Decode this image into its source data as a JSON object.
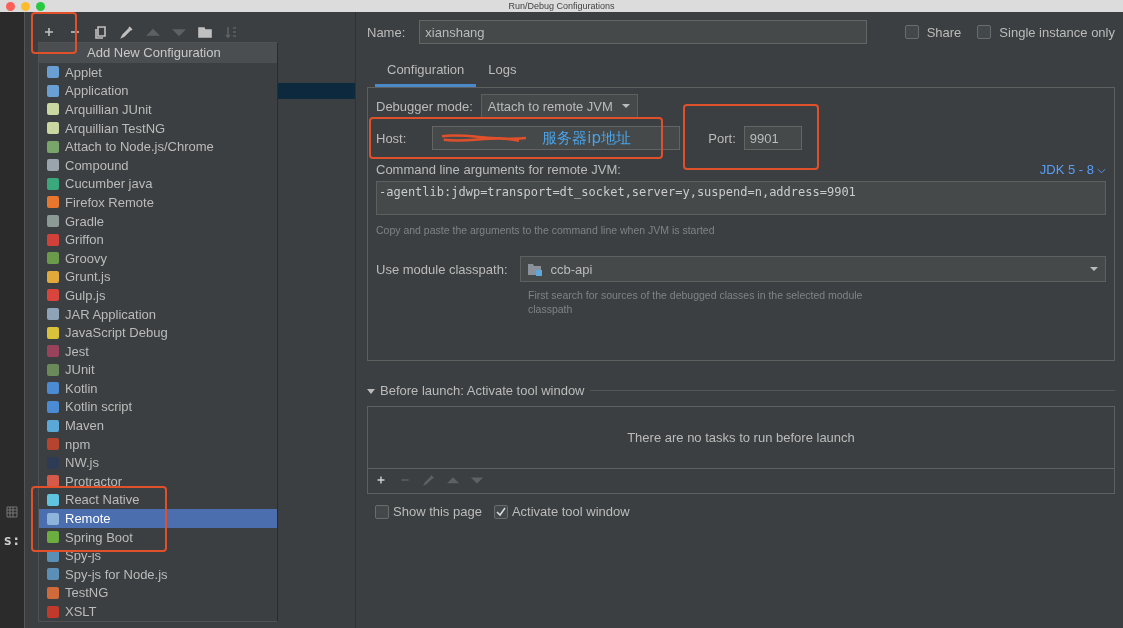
{
  "window": {
    "title": "Run/Debug Configurations"
  },
  "background": {
    "text": "s:"
  },
  "toolbar": {
    "buttons": [
      {
        "kind": "add",
        "disabled": false
      },
      {
        "kind": "remove",
        "disabled": false
      },
      {
        "kind": "copy",
        "disabled": false
      },
      {
        "kind": "edit",
        "disabled": false
      },
      {
        "kind": "up",
        "disabled": true
      },
      {
        "kind": "down",
        "disabled": true
      },
      {
        "kind": "folder",
        "disabled": false
      },
      {
        "kind": "sort",
        "disabled": true
      }
    ]
  },
  "popup": {
    "title": "Add New Configuration",
    "items": [
      {
        "label": "Applet",
        "color": "#6a9fd4",
        "selected": false
      },
      {
        "label": "Application",
        "color": "#6a9fd4",
        "selected": false
      },
      {
        "label": "Arquillian JUnit",
        "color": "#c8d8a0",
        "selected": false
      },
      {
        "label": "Arquillian TestNG",
        "color": "#c8d8a0",
        "selected": false
      },
      {
        "label": "Attach to Node.js/Chrome",
        "color": "#7aa56a",
        "selected": false
      },
      {
        "label": "Compound",
        "color": "#9aa4ad",
        "selected": false
      },
      {
        "label": "Cucumber java",
        "color": "#3aa87a",
        "selected": false
      },
      {
        "label": "Firefox Remote",
        "color": "#e8762d",
        "selected": false
      },
      {
        "label": "Gradle",
        "color": "#8c9a95",
        "selected": false
      },
      {
        "label": "Griffon",
        "color": "#d0413a",
        "selected": false
      },
      {
        "label": "Groovy",
        "color": "#6b9b4a",
        "selected": false
      },
      {
        "label": "Grunt.js",
        "color": "#e0a93a",
        "selected": false
      },
      {
        "label": "Gulp.js",
        "color": "#d9443c",
        "selected": false
      },
      {
        "label": "JAR Application",
        "color": "#8fa3b8",
        "selected": false
      },
      {
        "label": "JavaScript Debug",
        "color": "#d9c23a",
        "selected": false
      },
      {
        "label": "Jest",
        "color": "#99425b",
        "selected": false
      },
      {
        "label": "JUnit",
        "color": "#6a8a5a",
        "selected": false
      },
      {
        "label": "Kotlin",
        "color": "#4b8bd4",
        "selected": false
      },
      {
        "label": "Kotlin script",
        "color": "#4b8bd4",
        "selected": false
      },
      {
        "label": "Maven",
        "color": "#59a8d8",
        "selected": false
      },
      {
        "label": "npm",
        "color": "#b5452f",
        "selected": false
      },
      {
        "label": "NW.js",
        "color": "#2e3b55",
        "selected": false
      },
      {
        "label": "Protractor",
        "color": "#d65a4a",
        "selected": false
      },
      {
        "label": "React Native",
        "color": "#5fc4e0",
        "selected": false
      },
      {
        "label": "Remote",
        "color": "#8fb4dc",
        "selected": true
      },
      {
        "label": "Spring Boot",
        "color": "#6cad3f",
        "selected": false
      },
      {
        "label": "Spy-js",
        "color": "#5c8fb5",
        "selected": false
      },
      {
        "label": "Spy-js for Node.js",
        "color": "#5c8fb5",
        "selected": false
      },
      {
        "label": "TestNG",
        "color": "#d06a3a",
        "selected": false
      },
      {
        "label": "XSLT",
        "color": "#c0392b",
        "selected": false
      }
    ]
  },
  "name": {
    "label": "Name:",
    "value": "xianshang"
  },
  "share": {
    "label": "Share",
    "checked": false
  },
  "single_instance": {
    "label": "Single instance only",
    "checked": false
  },
  "tabs": [
    {
      "label": "Configuration",
      "selected": true
    },
    {
      "label": "Logs",
      "selected": false
    }
  ],
  "debugger_mode": {
    "label": "Debugger mode:",
    "value": "Attach to remote JVM"
  },
  "host": {
    "label": "Host:",
    "note": "服务器ip地址"
  },
  "port": {
    "label": "Port:",
    "value": "9901"
  },
  "args": {
    "label": "Command line arguments for remote JVM:",
    "jdk": "JDK 5 - 8",
    "value": "-agentlib:jdwp=transport=dt_socket,server=y,suspend=n,address=9901",
    "hint": "Copy and paste the arguments to the command line when JVM is started"
  },
  "module": {
    "label": "Use module classpath:",
    "value": "ccb-api",
    "hint": "First search for sources of the debugged classes in the selected module classpath"
  },
  "before_launch": {
    "title": "Before launch: Activate tool window",
    "expanded": true,
    "empty_text": "There are no tasks to run before launch",
    "tools": [
      {
        "kind": "add",
        "disabled": false
      },
      {
        "kind": "remove",
        "disabled": true
      },
      {
        "kind": "edit",
        "disabled": true
      },
      {
        "kind": "up",
        "disabled": true
      },
      {
        "kind": "down",
        "disabled": true
      }
    ]
  },
  "options": [
    {
      "label": "Show this page",
      "checked": false
    },
    {
      "label": "Activate tool window",
      "checked": true
    }
  ]
}
